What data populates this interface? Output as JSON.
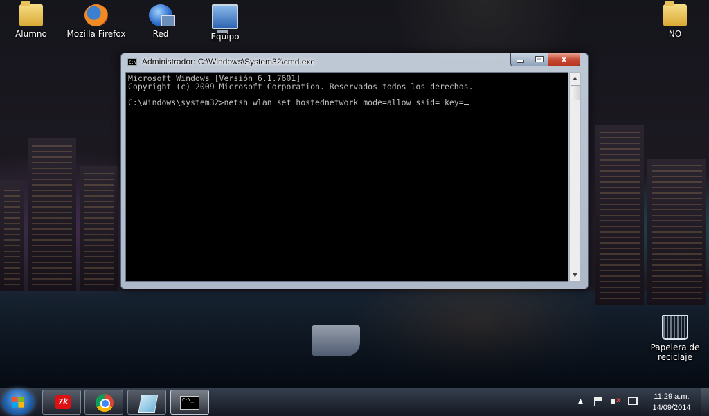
{
  "desktop": {
    "icons": [
      {
        "label": "Alumno",
        "icon": "user-folder-icon"
      },
      {
        "label": "Mozilla Firefox",
        "icon": "firefox-icon"
      },
      {
        "label": "Red",
        "icon": "network-icon"
      },
      {
        "label": "Equipo",
        "icon": "computer-icon"
      },
      {
        "label": "NO",
        "icon": "folder-icon"
      },
      {
        "label": "Papelera de reciclaje",
        "icon": "recycle-bin-icon"
      }
    ]
  },
  "window": {
    "title": "Administrador: C:\\Windows\\System32\\cmd.exe",
    "title_icon_text": "C:\\",
    "controls": {
      "minimize": "minimize",
      "maximize": "maximize",
      "close": "x"
    },
    "console_lines": [
      "Microsoft Windows [Versión 6.1.7601]",
      "Copyright (c) 2009 Microsoft Corporation. Reservados todos los derechos.",
      "",
      "C:\\Windows\\system32>netsh wlan set hostednetwork mode=allow ssid= key="
    ]
  },
  "taskbar": {
    "start": "start-orb",
    "pinned": [
      {
        "name": "app-launcher",
        "icon_text": "7k"
      },
      {
        "name": "chrome",
        "icon": "chrome-icon"
      },
      {
        "name": "notepad",
        "icon": "notes-icon"
      },
      {
        "name": "cmd",
        "icon_text": "C:\\_",
        "active": true
      }
    ],
    "tray": {
      "arrow": "▲",
      "volume_muted": "x"
    },
    "clock": {
      "time": "11:29 a.m.",
      "date": "14/09/2014"
    }
  }
}
